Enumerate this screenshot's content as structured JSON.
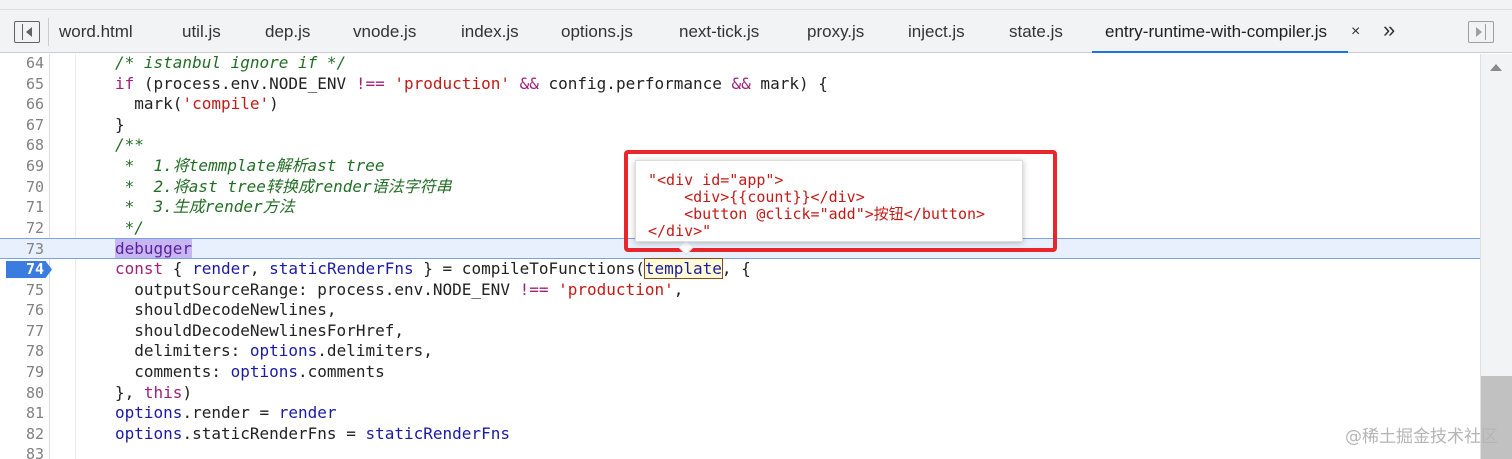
{
  "tabs": [
    {
      "label": "word.html",
      "active": false
    },
    {
      "label": "util.js",
      "active": false
    },
    {
      "label": "dep.js",
      "active": false
    },
    {
      "label": "vnode.js",
      "active": false
    },
    {
      "label": "index.js",
      "active": false
    },
    {
      "label": "options.js",
      "active": false
    },
    {
      "label": "next-tick.js",
      "active": false
    },
    {
      "label": "proxy.js",
      "active": false
    },
    {
      "label": "inject.js",
      "active": false
    },
    {
      "label": "state.js",
      "active": false
    },
    {
      "label": "entry-runtime-with-compiler.js",
      "active": true
    }
  ],
  "tab_close": "×",
  "tab_more": "»",
  "editor": {
    "highlighted_line": 73,
    "breakpoint_line": 74,
    "line_numbers": [
      "64",
      "65",
      "66",
      "67",
      "68",
      "69",
      "70",
      "71",
      "72",
      "73",
      "74",
      "75",
      "76",
      "77",
      "78",
      "79",
      "80",
      "81",
      "82",
      "83"
    ],
    "lines": [
      [
        {
          "t": "/* istanbul ignore if */",
          "c": "cm"
        }
      ],
      [
        {
          "t": "if",
          "c": "kw"
        },
        {
          "t": " (process.env.NODE_ENV "
        },
        {
          "t": "!==",
          "c": "kw"
        },
        {
          "t": " "
        },
        {
          "t": "'production'",
          "c": "str"
        },
        {
          "t": " "
        },
        {
          "t": "&&",
          "c": "kw"
        },
        {
          "t": " config.performance "
        },
        {
          "t": "&&",
          "c": "kw"
        },
        {
          "t": " mark) {"
        }
      ],
      [
        {
          "t": "  mark("
        },
        {
          "t": "'compile'",
          "c": "str"
        },
        {
          "t": ")"
        }
      ],
      [
        {
          "t": "}"
        }
      ],
      [
        {
          "t": "/**",
          "c": "cm"
        }
      ],
      [
        {
          "t": " *  1.将temmplate解析ast tree",
          "c": "cm"
        }
      ],
      [
        {
          "t": " *  2.将ast tree转换成render语法字符串",
          "c": "cm"
        }
      ],
      [
        {
          "t": " *  3.生成render方法",
          "c": "cm"
        }
      ],
      [
        {
          "t": " */",
          "c": "cm"
        }
      ],
      [
        {
          "t": "debugger",
          "c": "dbg"
        }
      ],
      [
        {
          "t": "const",
          "c": "kw"
        },
        {
          "t": " { "
        },
        {
          "t": "render",
          "c": "id"
        },
        {
          "t": ", "
        },
        {
          "t": "staticRenderFns",
          "c": "id"
        },
        {
          "t": " } = compileToFunctions("
        },
        {
          "t": "template",
          "c": "tpl"
        },
        {
          "t": ", {"
        }
      ],
      [
        {
          "t": "  outputSourceRange: process.env.NODE_ENV "
        },
        {
          "t": "!==",
          "c": "kw"
        },
        {
          "t": " "
        },
        {
          "t": "'production'",
          "c": "str"
        },
        {
          "t": ","
        }
      ],
      [
        {
          "t": "  shouldDecodeNewlines,"
        }
      ],
      [
        {
          "t": "  shouldDecodeNewlinesForHref,"
        }
      ],
      [
        {
          "t": "  delimiters: "
        },
        {
          "t": "options",
          "c": "id"
        },
        {
          "t": ".delimiters,"
        }
      ],
      [
        {
          "t": "  comments: "
        },
        {
          "t": "options",
          "c": "id"
        },
        {
          "t": ".comments"
        }
      ],
      [
        {
          "t": "}, "
        },
        {
          "t": "this",
          "c": "kw"
        },
        {
          "t": ")"
        }
      ],
      [
        {
          "t": "options",
          "c": "id"
        },
        {
          "t": ".render = "
        },
        {
          "t": "render",
          "c": "id"
        }
      ],
      [
        {
          "t": "options",
          "c": "id"
        },
        {
          "t": ".staticRenderFns = "
        },
        {
          "t": "staticRenderFns",
          "c": "id"
        }
      ],
      [
        {
          "t": ""
        }
      ]
    ]
  },
  "popover": {
    "lines": [
      "\"<div id=\"app\">",
      "    <div>{{count}}</div>",
      "    <button @click=\"add\">按钮</button>",
      "</div>\""
    ]
  },
  "watermark": "@稀土掘金技术社区",
  "colors": {
    "accent": "#1a73e8",
    "annotation_box": "#e8262b",
    "breakpoint": "#3b7ce0"
  }
}
